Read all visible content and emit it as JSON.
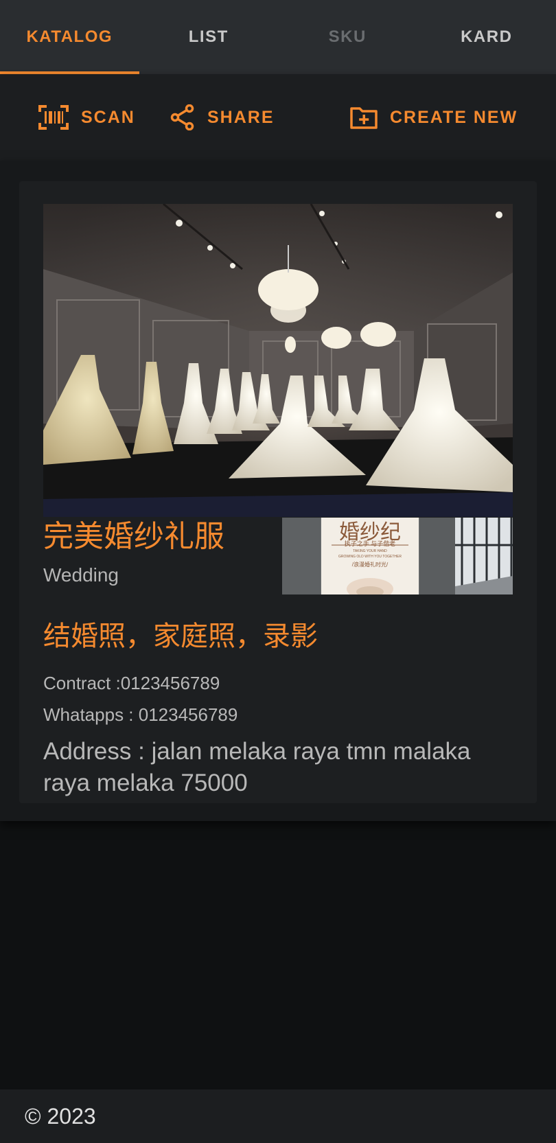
{
  "tabs": [
    {
      "label": "KATALOG",
      "state": "active"
    },
    {
      "label": "LIST",
      "state": "normal"
    },
    {
      "label": "SKU",
      "state": "disabled"
    },
    {
      "label": "KARD",
      "state": "normal"
    }
  ],
  "toolbar": {
    "scan_label": "SCAN",
    "share_label": "SHARE",
    "create_label": "CREATE NEW",
    "scan_icon": "barcode-scan-icon",
    "share_icon": "share-icon",
    "create_icon": "add-box-icon"
  },
  "card": {
    "shop_name": "完美婚纱礼服",
    "category": "Wedding",
    "services": "结婚照，家庭照，录影",
    "contract": "Contract :0123456789",
    "whatsapp": "Whatapps : 0123456789",
    "address": "Address : jalan melaka raya tmn malaka raya melaka 75000",
    "banner": {
      "title": "婚纱纪",
      "line1": "执子之手 与子偕老",
      "line2": "TAKING YOUR HAND",
      "line3": "GROWING OLD WITH YOU TOGETHER",
      "line4": "/浪漫婚礼时光/"
    }
  },
  "footer": {
    "copyright": "© 2023"
  },
  "colors": {
    "accent": "#f58a2f",
    "tabbar": "#2a2d30",
    "toolbar": "#1c1e20",
    "card": "#1d1f21",
    "background": "#0f1112"
  }
}
